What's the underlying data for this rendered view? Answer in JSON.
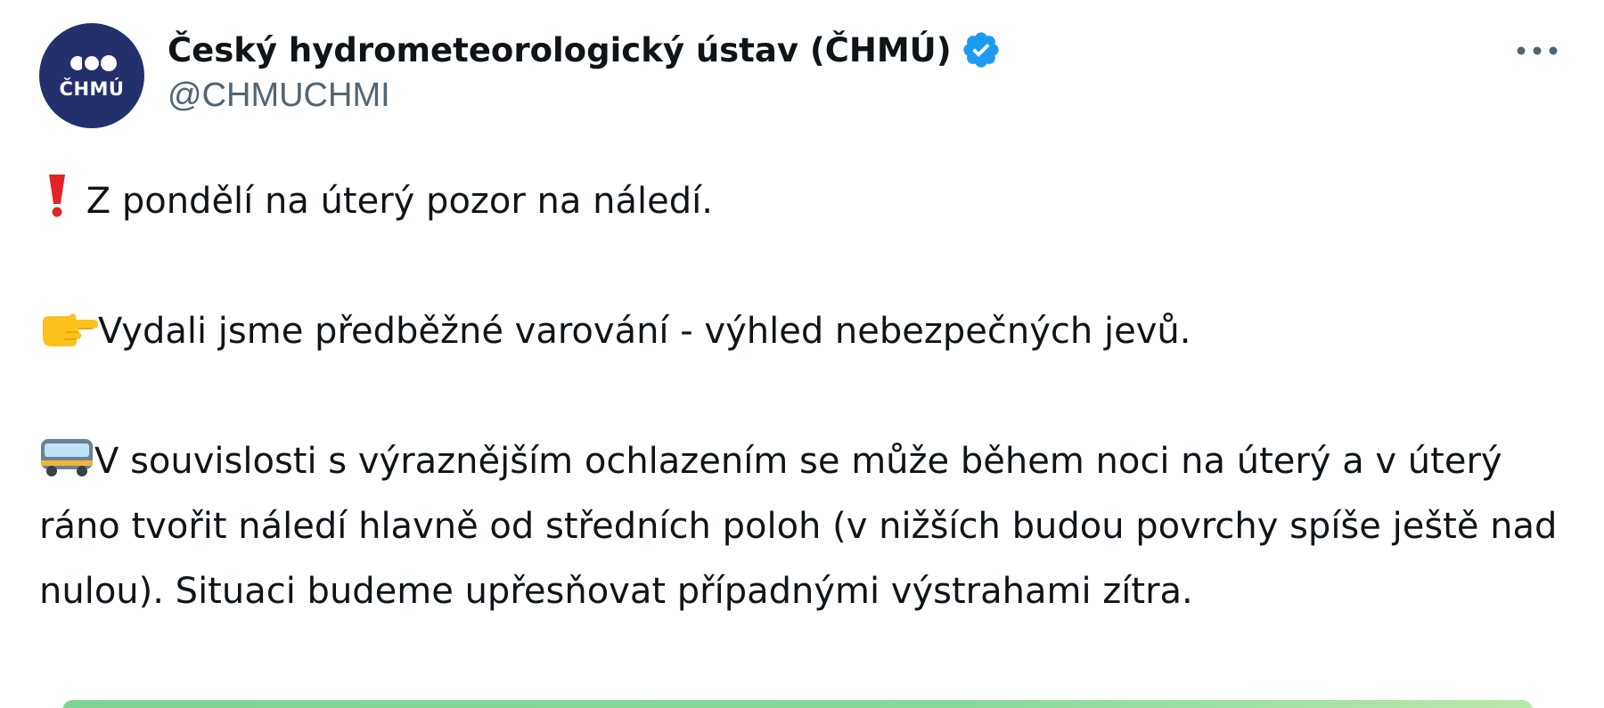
{
  "author": {
    "display_name": "Český hydrometeorologický ústav (ČHMÚ)",
    "handle": "@CHMUCHMI",
    "verified": true,
    "avatar_text": "ČHMÚ",
    "avatar_color": "#23306c"
  },
  "tweet": {
    "paragraphs": [
      {
        "icon": "exclamation-icon",
        "text": "Z pondělí na úterý pozor na náledí."
      },
      {
        "icon": "pointing-hand-icon",
        "text": "Vydali jsme předběžné varování - výhled nebezpečných jevů."
      },
      {
        "icon": "bus-icon",
        "text": "V souvislosti s výraznějším ochlazením se může během noci na úterý a v úterý ráno tvořit náledí hlavně od středních poloh (v nižších budou povrchy spíše ještě nad nulou). Situaci budeme upřesňovat případnými výstrahami zítra."
      }
    ]
  },
  "colors": {
    "verified_blue": "#1d9bf0",
    "handle_gray": "#536471",
    "text": "#0f1419"
  },
  "icons": {
    "more": "more-options-icon",
    "verified": "verified-badge-icon"
  }
}
